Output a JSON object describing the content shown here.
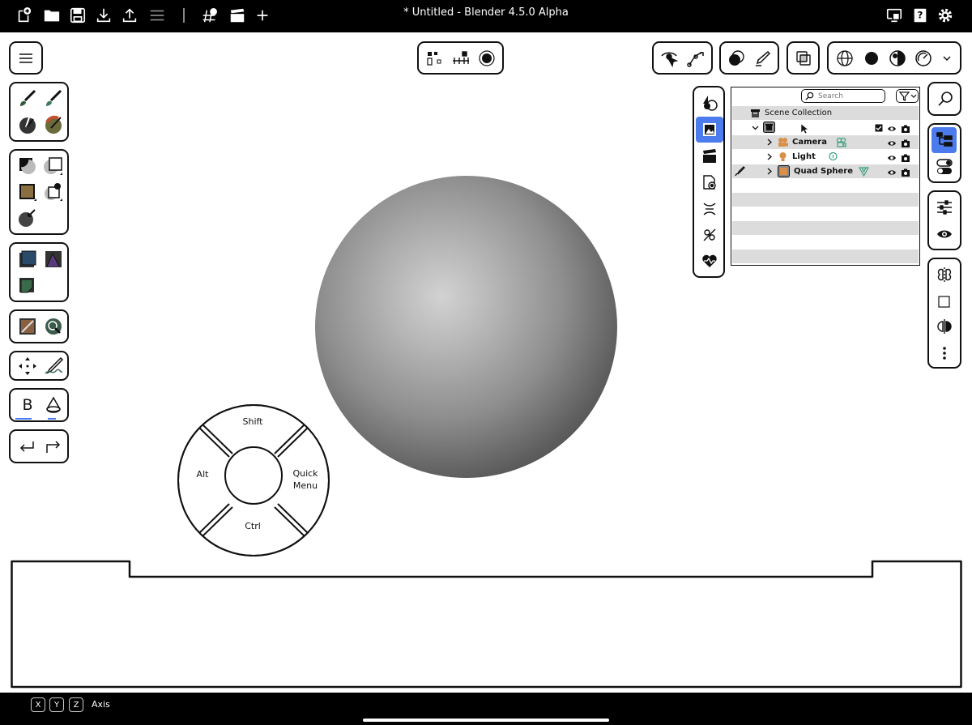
{
  "app": {
    "window_title": "* Untitled - Blender 4.5.0 Alpha"
  },
  "topbar": {
    "left_icons": [
      "new-file-icon",
      "open-folder-icon",
      "save-icon",
      "import-icon",
      "export-icon",
      "menu-lines-icon",
      "render-icon",
      "clapperboard-icon",
      "add-icon"
    ],
    "right_icons": [
      "display-icon",
      "help-icon",
      "settings-icon"
    ]
  },
  "outliner": {
    "search_placeholder": "Search",
    "scene_collection": "Scene Collection",
    "items": [
      {
        "label": "Camera"
      },
      {
        "label": "Light"
      },
      {
        "label": "Quad Sphere"
      }
    ]
  },
  "wheel": {
    "top": "Shift",
    "left": "Alt",
    "right_line1": "Quick",
    "right_line2": "Menu",
    "bottom": "Ctrl"
  },
  "left_toolbar": {
    "text_tool_glyph": "B"
  },
  "statusbar": {
    "keys": [
      "X",
      "Y",
      "Z"
    ],
    "text": "Axis"
  },
  "colors": {
    "accent": "#4b7bec",
    "bar_background": "#000000"
  }
}
